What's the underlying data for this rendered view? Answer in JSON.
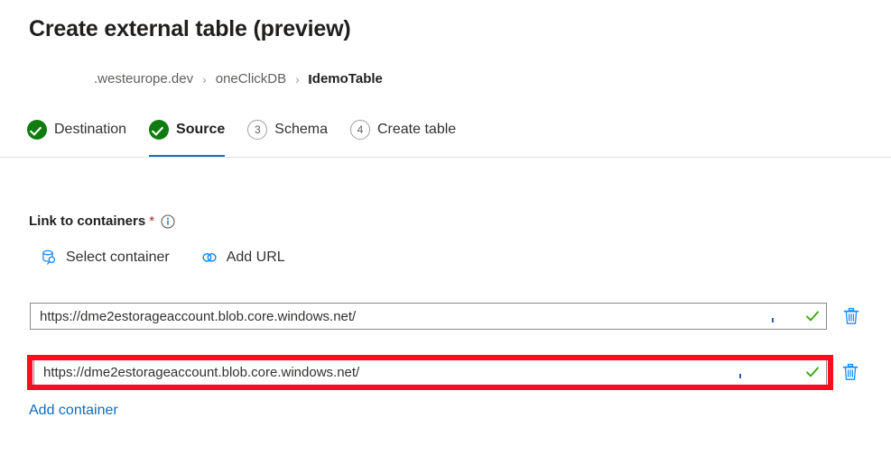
{
  "page": {
    "title": "Create external table (preview)"
  },
  "breadcrumb": {
    "items": [
      {
        "label": ".westeurope.dev",
        "current": false
      },
      {
        "label": "oneClickDB",
        "current": false
      },
      {
        "label": "demoTable",
        "current": true
      }
    ],
    "separator": "›"
  },
  "stepper": {
    "steps": [
      {
        "label": "Destination",
        "state": "done",
        "marker": "check-icon",
        "active": false
      },
      {
        "label": "Source",
        "state": "done",
        "marker": "check-icon",
        "active": true
      },
      {
        "label": "Schema",
        "state": "pending",
        "marker": "3",
        "active": false
      },
      {
        "label": "Create table",
        "state": "pending",
        "marker": "4",
        "active": false
      }
    ]
  },
  "form": {
    "label": "Link to containers",
    "required_mark": "*",
    "info_icon": "info-icon",
    "actions": [
      {
        "label": "Select container",
        "icon": "database-search-icon"
      },
      {
        "label": "Add URL",
        "icon": "link-icon"
      }
    ],
    "containers": [
      {
        "url": "https://dme2estorageaccount.blob.core.windows.net/",
        "valid": true,
        "highlighted": false,
        "delete_icon": "trash-icon"
      },
      {
        "url": "https://dme2estorageaccount.blob.core.windows.net/",
        "valid": true,
        "highlighted": true,
        "delete_icon": "trash-icon"
      }
    ],
    "add_container_label": "Add container"
  },
  "colors": {
    "accent": "#0078d4",
    "link": "#0f6cbd",
    "success": "#107c10",
    "check": "#3ba911",
    "required": "#a4262c",
    "highlight": "#fc0d1b",
    "icon_blue": "#1a8cff"
  }
}
